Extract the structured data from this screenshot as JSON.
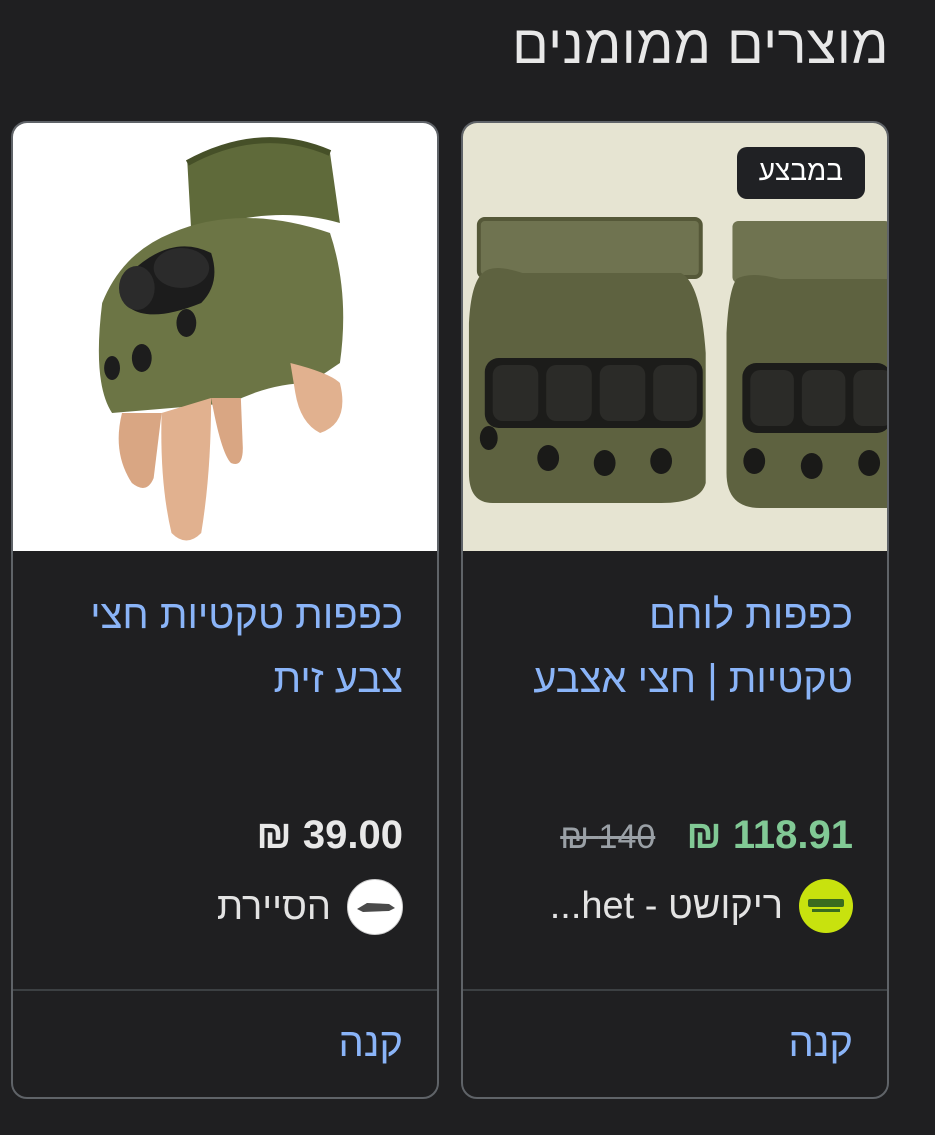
{
  "section_title": "מוצרים ממומנים",
  "products": [
    {
      "title_line1": "כפפות לוחם",
      "title_line2": "טקטיות | חצי אצבע",
      "badge": "במבצע",
      "price": "118.91 ₪",
      "old_price": "140 ₪",
      "merchant": "ריקושט - het...",
      "buy_label": "קנה",
      "accent_color": "#81c995"
    },
    {
      "title_line1": "כפפות טקטיות חצי",
      "title_line2": "צבע זית",
      "price": "39.00 ₪",
      "merchant": "הסיירת",
      "buy_label": "קנה"
    }
  ]
}
